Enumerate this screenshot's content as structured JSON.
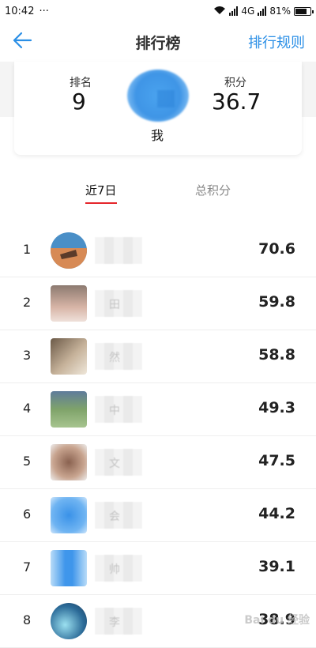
{
  "status_bar": {
    "time": "10:42",
    "dots": "···",
    "network": "4G",
    "battery": "81%"
  },
  "nav": {
    "title": "排行榜",
    "rules": "排行规则"
  },
  "summary": {
    "rank_label": "排名",
    "rank_value": "9",
    "score_label": "积分",
    "score_value": "36.7",
    "me_label": "我"
  },
  "tabs": {
    "recent": "近7日",
    "total": "总积分"
  },
  "leaderboard": [
    {
      "rank": "1",
      "name": "",
      "points": "70.6",
      "avatar_color": "#d78a55"
    },
    {
      "rank": "2",
      "name": "田",
      "points": "59.8",
      "avatar_color": "#c9a79a"
    },
    {
      "rank": "3",
      "name": "然",
      "points": "58.8",
      "avatar_color": "#b49a7c"
    },
    {
      "rank": "4",
      "name": "中",
      "points": "49.3",
      "avatar_color": "#7fa36a"
    },
    {
      "rank": "5",
      "name": "文",
      "points": "47.5",
      "avatar_color": "#a07a68"
    },
    {
      "rank": "6",
      "name": "会",
      "points": "44.2",
      "avatar_color": "#4a9ff0"
    },
    {
      "rank": "7",
      "name": "帅",
      "points": "39.1",
      "avatar_color": "#3f96eb"
    },
    {
      "rank": "8",
      "name": "李",
      "points": "38.9",
      "avatar_color": "#4aa0c0"
    }
  ],
  "watermark": "Bai du 经验",
  "colors": {
    "accent": "#2b8fe6",
    "tab_underline": "#e5262b"
  }
}
